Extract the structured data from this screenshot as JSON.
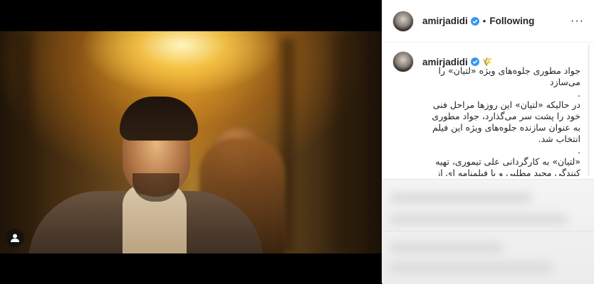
{
  "post": {
    "username": "amirjadidi",
    "follow_status": "Following",
    "separator": "•",
    "more_options": "···"
  },
  "caption": {
    "username": "amirjadidi",
    "emoji": "🌾",
    "text": "جواد مطوری جلوه‌های ویژه «لتیان» را می‌سازد\n.\nدر حالیکه «لتیان» این روزها مراحل فنی خود را پشت سر می‌گذارد، جواد مطوری به عنوان سازنده جلوه‌های ویژه این فیلم انتخاب شد.\n.\n«لتیان» به کارگردانی علی تیموری، تهیه کنندگی مجید مطلبی و با فیلمنامه ای از اکتای براهنی و"
  },
  "icons": {
    "verified": "verified-badge-icon",
    "user_tag": "user-tag-icon",
    "more": "more-options-icon"
  },
  "colors": {
    "verified_blue": "#3897f0",
    "text": "#262626"
  }
}
